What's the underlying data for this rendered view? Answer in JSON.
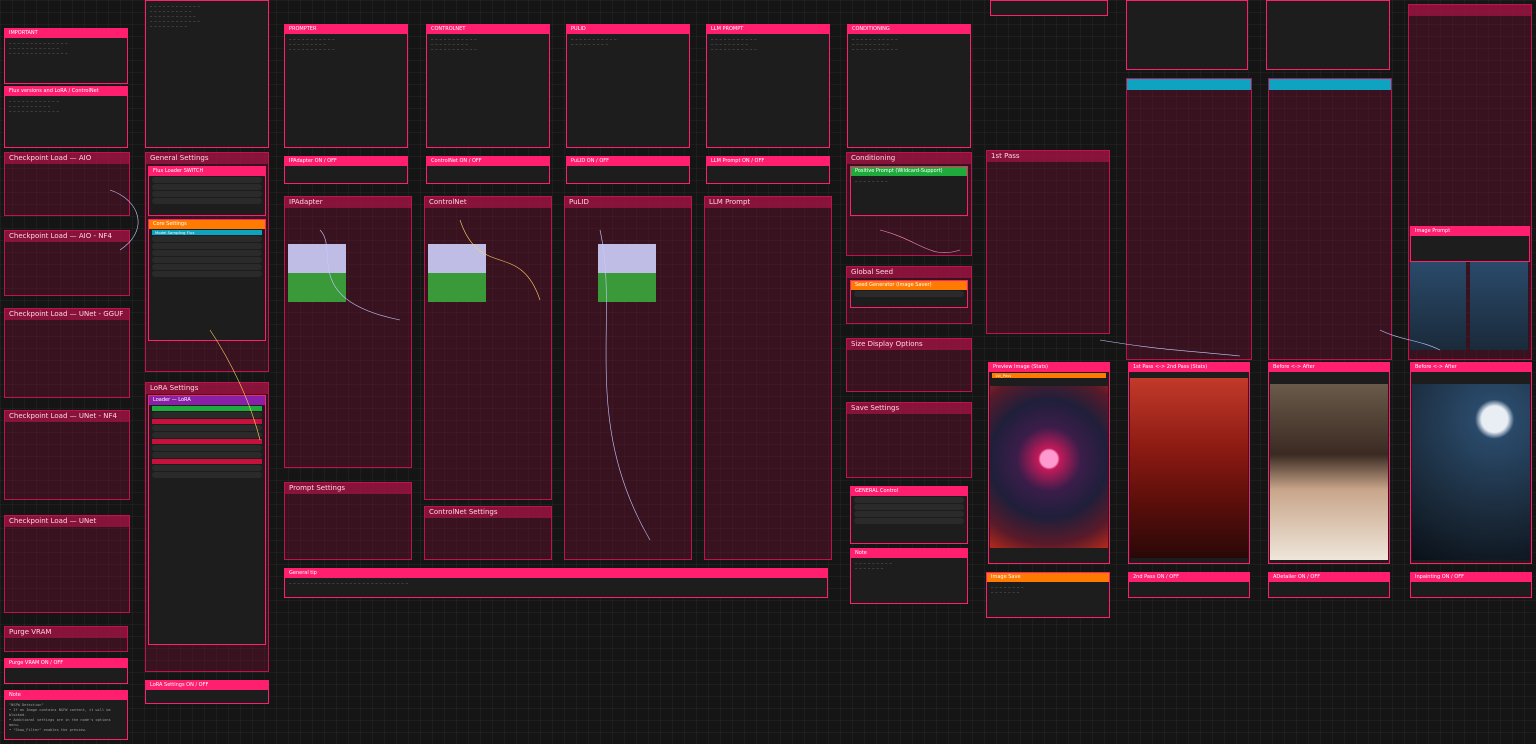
{
  "notes": {
    "important_title": "IMPORTANT",
    "flux_versions_title": "Flux versions and LoRA / ControlNet",
    "prompter_title": "PROMPTER",
    "controlnet_title": "CONTROLNET",
    "pulid_title": "PULID",
    "llm_prompt_title": "LLM PROMPT",
    "conditioning_title": "CONDITIONING",
    "note_title": "Note",
    "note_text": "\"NSFW Detection\"\n• If an Image contains NSFW content, it will be blocked.\n• Additional settings are in the node's options menu.\n• \"Show_Filter\" enables the preview.",
    "general_title": "General tip"
  },
  "groups": {
    "ckpt_aio": "Checkpoint Load — AIO",
    "ckpt_aio_nf4": "Checkpoint Load — AIO - NF4",
    "ckpt_unet_gguf": "Checkpoint Load — UNet - GGUF",
    "ckpt_unet_nf4": "Checkpoint Load — UNet - NF4",
    "ckpt_unet": "Checkpoint Load — UNet",
    "general_settings": "General Settings",
    "lora_settings": "LoRA Settings",
    "purge_vram": "Purge VRAM",
    "ipadapter": "IPAdapter",
    "controlnet": "ControlNet",
    "pulid": "PuLID",
    "llm_prompt": "LLM Prompt",
    "conditioning": "Conditioning",
    "global_seed": "Global Seed",
    "size_display": "Size Display Options",
    "save_settings": "Save Settings",
    "first_pass": "1st Pass",
    "prompt_settings": "Prompt Settings",
    "controlnet_settings": "ControlNet Settings"
  },
  "toggles": {
    "ipadapter": "IPAdapter ON / OFF",
    "controlnet": "ControlNet ON / OFF",
    "pulid": "PuLID ON / OFF",
    "llm_prompt": "LLM Prompt ON / OFF",
    "purge": "Purge VRAM ON / OFF",
    "lora": "LoRA Settings ON / OFF",
    "second_pass": "2nd Pass ON / OFF",
    "adetailer": "ADetailer ON / OFF",
    "inpainting": "Inpainting ON / OFF"
  },
  "misc": {
    "flux_loader_switch": "Flux Loader SWITCH",
    "core_settings": "Core Settings",
    "model_sampling": "Model Sampling Flux",
    "positive_prompt": "Positive Prompt (Wildcard-Support)",
    "seed_generator": "Seed Generator (Image Saver)",
    "image_save": "Image Save",
    "general_control": "GENERAL Control",
    "preview_stats": "Preview Image (Stats)",
    "pass_preview": "1st Pass <-> 2nd Pass (Stats)",
    "before_after": "Before <-> After",
    "image_prompt": "Image Prompt",
    "lora_loader": "Loader — LoRA",
    "first_pass_label": "1st_Pass"
  },
  "colors": {
    "accent": "#ff1f6e",
    "group_border": "#c0124e",
    "orange": "#ff7a00",
    "green": "#1faa3c",
    "teal": "#0ea3c0",
    "background": "#151515"
  }
}
